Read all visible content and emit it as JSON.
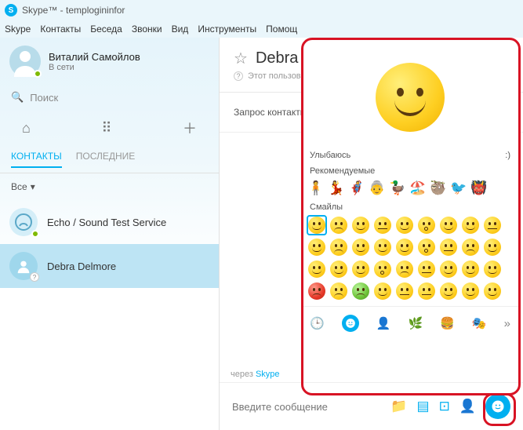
{
  "titlebar": "Skype™ - templogininfor",
  "menu": {
    "skype": "Skype",
    "contacts": "Контакты",
    "chat": "Беседа",
    "calls": "Звонки",
    "view": "Вид",
    "tools": "Инструменты",
    "help": "Помощ"
  },
  "profile": {
    "name": "Виталий Самойлов",
    "status": "В сети"
  },
  "search": {
    "placeholder": "Поиск"
  },
  "tabs": {
    "contacts": "КОНТАКТЫ",
    "recent": "ПОСЛЕДНИЕ"
  },
  "filter": "Все",
  "contacts_list": [
    {
      "name": "Echo / Sound Test Service"
    },
    {
      "name": "Debra Delmore"
    }
  ],
  "chat": {
    "title": "Debra De",
    "subtitle": "Этот пользоват",
    "request": "Запрос контактных",
    "via_prefix": "через ",
    "via_link": "Skype",
    "input_placeholder": "Введите сообщение"
  },
  "emoji": {
    "name": "Улыбаюсь",
    "shortcut": ":)",
    "recommended": "Рекомендуемые",
    "smiles": "Смайлы"
  }
}
